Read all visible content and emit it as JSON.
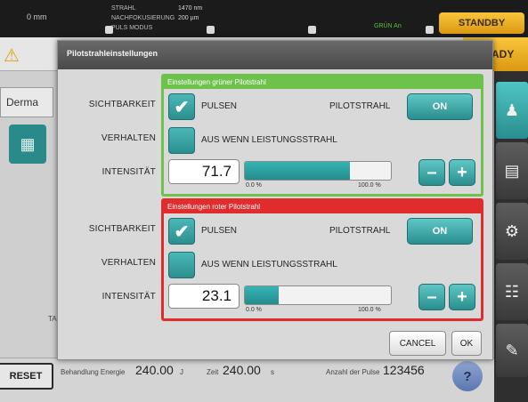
{
  "topbar": {
    "distance": "0 mm",
    "labels": [
      "STRAHL",
      "NACHFOKUSIERUNG",
      "PULS MODUS"
    ],
    "values": [
      "1470 nm",
      "200 µm"
    ],
    "green_status": "GRÜN An",
    "standby_label": "STANDBY"
  },
  "background": {
    "ready_label": "EADY",
    "tab_label": "Derma",
    "reset_label": "RESET",
    "small_label": "TAL",
    "bottom": {
      "energy_label": "Behandlung Energie",
      "energy_value": "240.00",
      "energy_unit": "J",
      "time_label": "Zeit",
      "time_value": "240.00",
      "time_unit": "s",
      "pulses_label": "Anzahl der Pulse",
      "pulses_value": "123456",
      "help_label": "?"
    }
  },
  "dialog": {
    "title": "Pilotstrahleinstellungen",
    "row_labels": {
      "visibility": "SICHTBARKEIT",
      "behavior": "VERHALTEN",
      "intensity": "INTENSITÄT"
    },
    "green": {
      "header": "Einstellungen grüner Pilotstrahl",
      "pulse_label": "PULSEN",
      "pulse_checked": true,
      "pilot_label": "PILOTSTRAHL",
      "pilot_button": "ON",
      "behavior_label": "AUS WENN LEISTUNGSSTRAHL",
      "behavior_checked": false,
      "intensity_value": "71.7",
      "intensity_fraction": 0.717,
      "min_label": "0.0 %",
      "max_label": "100.0 %",
      "minus_label": "–",
      "plus_label": "+"
    },
    "red": {
      "header": "Einstellungen roter Pilotstrahl",
      "pulse_label": "PULSEN",
      "pulse_checked": true,
      "pilot_label": "PILOTSTRAHL",
      "pilot_button": "ON",
      "behavior_label": "AUS WENN LEISTUNGSSTRAHL",
      "behavior_checked": false,
      "intensity_value": "23.1",
      "intensity_fraction": 0.231,
      "min_label": "0.0 %",
      "max_label": "100.0 %",
      "minus_label": "–",
      "plus_label": "+"
    },
    "cancel_label": "CANCEL",
    "ok_label": "OK"
  },
  "colors": {
    "accent_teal": "#2a8e8e",
    "green_section": "#6cc24a",
    "red_section": "#e02c2c",
    "standby": "#f0b22a"
  }
}
